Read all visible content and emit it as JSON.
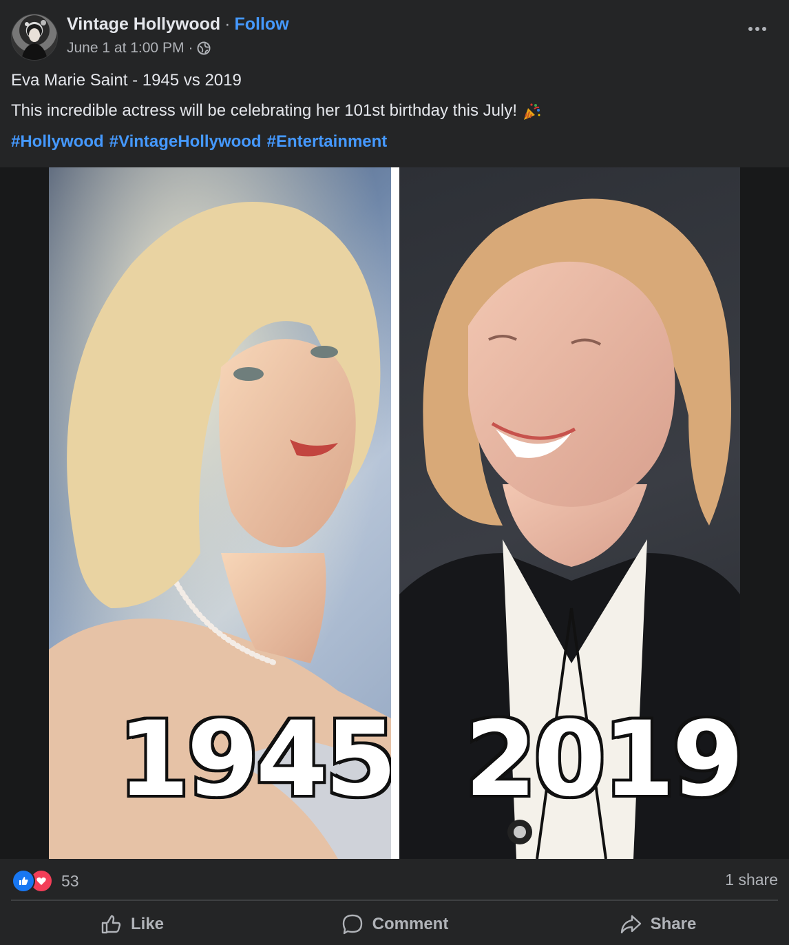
{
  "header": {
    "page_name": "Vintage Hollywood",
    "separator": "·",
    "follow_label": "Follow",
    "timestamp": "June 1 at 1:00 PM",
    "meta_separator": "·",
    "privacy_icon": "globe-icon",
    "more_icon": "more-options-icon"
  },
  "post": {
    "line1": "Eva Marie Saint - 1945 vs 2019",
    "line2": "This incredible actress will be celebrating her 101st birthday this July!",
    "emoji_icon": "party-popper-icon",
    "hashtags": [
      "#Hollywood",
      "#VintageHollywood",
      "#Entertainment"
    ]
  },
  "media": {
    "left_year": "1945",
    "right_year": "2019"
  },
  "stats": {
    "reaction_icons": [
      "like-icon",
      "love-icon"
    ],
    "reaction_count": "53",
    "shares": "1 share"
  },
  "actions": {
    "like_label": "Like",
    "comment_label": "Comment",
    "share_label": "Share"
  },
  "colors": {
    "background": "#242526",
    "text": "#e4e6eb",
    "muted": "#b0b3b8",
    "link": "#4599ff",
    "like_blue": "#1877f2",
    "love_red": "#f33e58"
  }
}
